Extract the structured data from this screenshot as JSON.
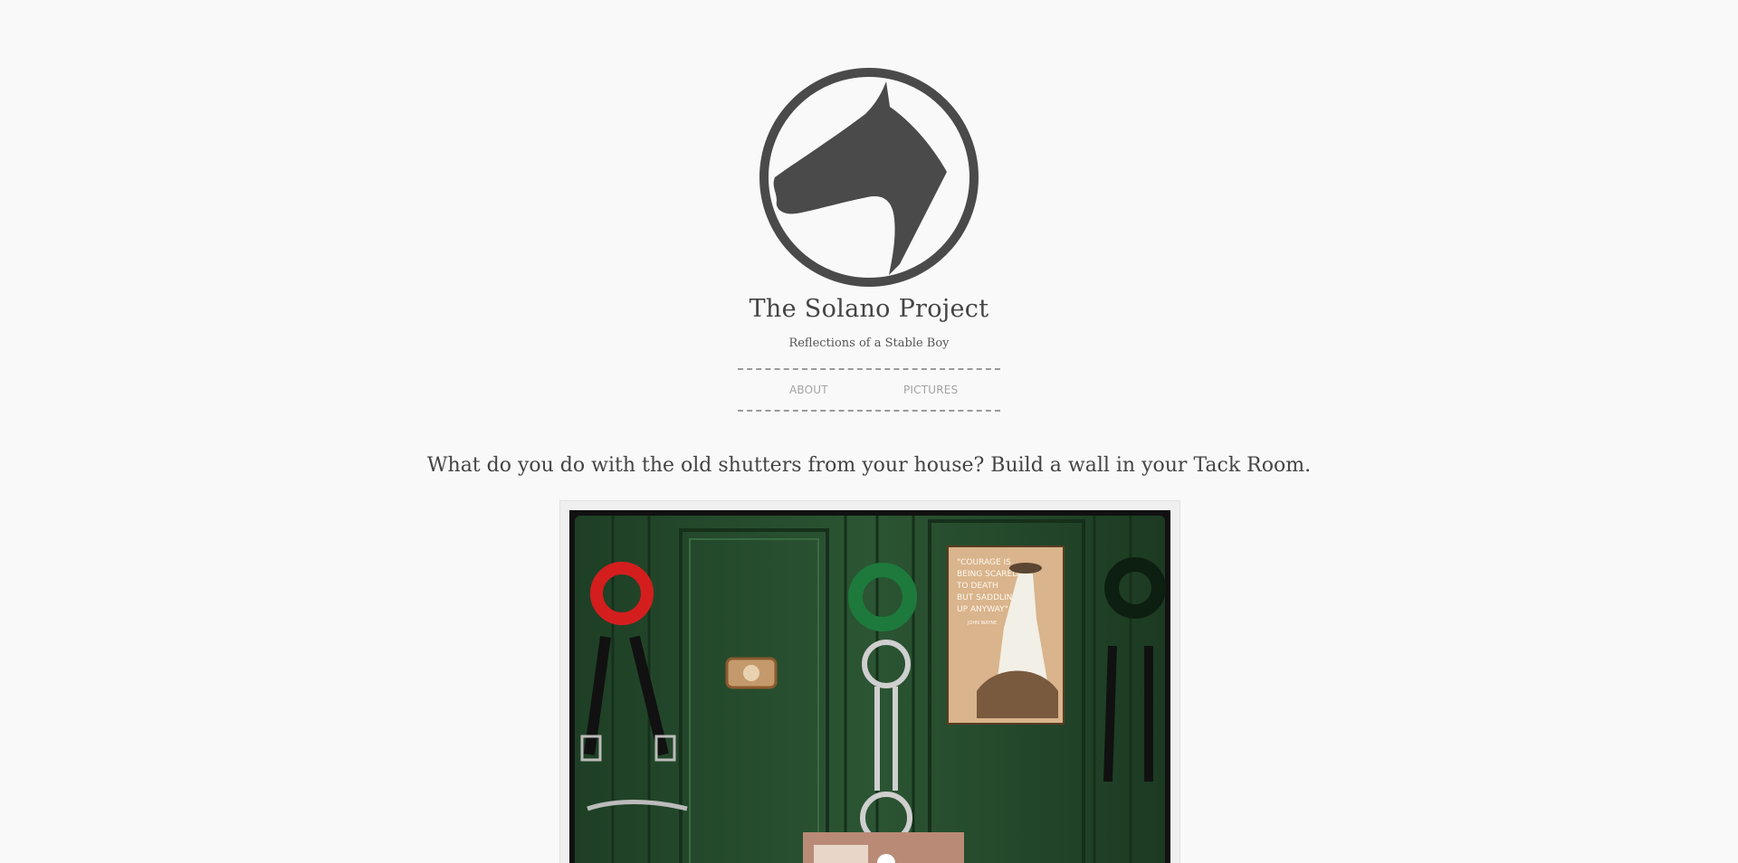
{
  "site": {
    "title": "The Solano Project",
    "tagline": "Reflections of a Stable Boy",
    "logo_icon": "horse-head-icon",
    "logo_color": "#4a4a4a"
  },
  "nav": {
    "items": [
      {
        "label": "ABOUT"
      },
      {
        "label": "PICTURES"
      }
    ]
  },
  "post": {
    "title": "What do you do with the old shutters from your house? Build a wall in your Tack Room.",
    "image": {
      "poster_text": "\"COURAGE IS BEING SCARED TO DEATH BUT SADDLING UP ANYWAY\"",
      "poster_credit": "JOHN WAYNE"
    }
  },
  "colors": {
    "background": "#f9f9f9",
    "text": "#444444",
    "nav_text": "#a3a3a3",
    "wall_green": "#234a2c"
  }
}
